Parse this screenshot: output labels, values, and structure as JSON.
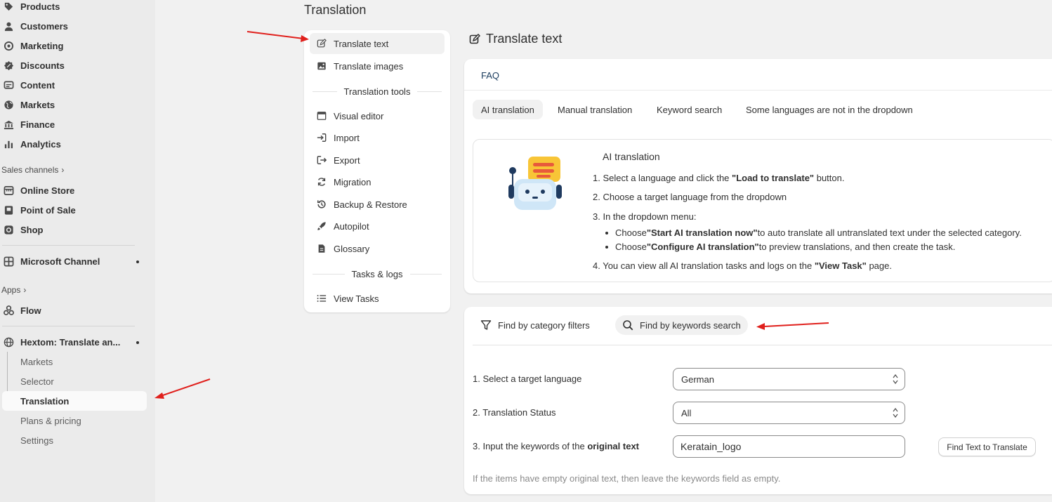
{
  "sidebar": {
    "items": [
      {
        "label": "Products",
        "icon": "tag-icon"
      },
      {
        "label": "Customers",
        "icon": "person-icon"
      },
      {
        "label": "Marketing",
        "icon": "target-icon"
      },
      {
        "label": "Discounts",
        "icon": "discount-icon"
      },
      {
        "label": "Content",
        "icon": "content-icon"
      },
      {
        "label": "Markets",
        "icon": "globe-icon"
      },
      {
        "label": "Finance",
        "icon": "bank-icon"
      },
      {
        "label": "Analytics",
        "icon": "bar-chart-icon"
      }
    ],
    "sales_channels_label": "Sales channels",
    "channels": [
      {
        "label": "Online Store",
        "icon": "store-icon"
      },
      {
        "label": "Point of Sale",
        "icon": "pos-icon"
      },
      {
        "label": "Shop",
        "icon": "shop-icon"
      }
    ],
    "microsoft": {
      "label": "Microsoft Channel",
      "icon": "grid-icon"
    },
    "apps_label": "Apps",
    "flow": {
      "label": "Flow",
      "icon": "flow-icon"
    },
    "hextom": {
      "label": "Hextom: Translate an...",
      "icon": "globe-icon"
    },
    "hextom_sub": [
      "Markets",
      "Selector",
      "Translation",
      "Plans & pricing",
      "Settings"
    ]
  },
  "page": {
    "title": "Translation"
  },
  "left_menu": {
    "items": [
      {
        "label": "Translate text",
        "icon": "edit-icon"
      },
      {
        "label": "Translate images",
        "icon": "image-icon"
      }
    ],
    "tools_header": "Translation tools",
    "tools": [
      {
        "label": "Visual editor",
        "icon": "window-icon"
      },
      {
        "label": "Import",
        "icon": "import-icon"
      },
      {
        "label": "Export",
        "icon": "export-icon"
      },
      {
        "label": "Migration",
        "icon": "refresh-icon"
      },
      {
        "label": "Backup & Restore",
        "icon": "backup-icon"
      },
      {
        "label": "Autopilot",
        "icon": "rocket-icon"
      },
      {
        "label": "Glossary",
        "icon": "document-icon"
      }
    ],
    "tasks_header": "Tasks & logs",
    "tasks": [
      {
        "label": "View Tasks",
        "icon": "list-icon"
      }
    ]
  },
  "content": {
    "title": "Translate text",
    "faq": {
      "label": "FAQ",
      "tabs": [
        "AI translation",
        "Manual translation",
        "Keyword search",
        "Some languages are not in the dropdown"
      ],
      "ai_title": "AI translation",
      "step1_pre": "1. Select a language and click the ",
      "step1_bold": "\"Load to translate\"",
      "step1_post": " button.",
      "step2": "2. Choose a target language from the dropdown",
      "step3": "3. In the dropdown menu:",
      "bullet1_pre": "Choose ",
      "bullet1_bold": "\"Start AI translation now\"",
      "bullet1_post": " to auto translate all untranslated text under the selected category.",
      "bullet2_pre": "Choose ",
      "bullet2_bold": "\"Configure AI translation\"",
      "bullet2_post": " to preview translations, and then create the task.",
      "step4_pre": "4. You can view all AI translation tasks and logs on the ",
      "step4_bold": "\"View Task\"",
      "step4_post": " page."
    },
    "search": {
      "tabs": [
        "Find by category filters",
        "Find by keywords search"
      ],
      "field1_label": "1. Select a target language",
      "field1_value": "German",
      "field2_label": "2. Translation Status",
      "field2_value": "All",
      "field3_label_pre": "3. Input the keywords of the ",
      "field3_label_bold": "original text",
      "field3_value": "Keratain_logo",
      "button": "Find Text to Translate",
      "hint": "If the items have empty original text, then leave the keywords field as empty."
    }
  },
  "colors": {
    "annotation_arrow": "#e0201c",
    "faq_label": "#1a3c5e"
  }
}
